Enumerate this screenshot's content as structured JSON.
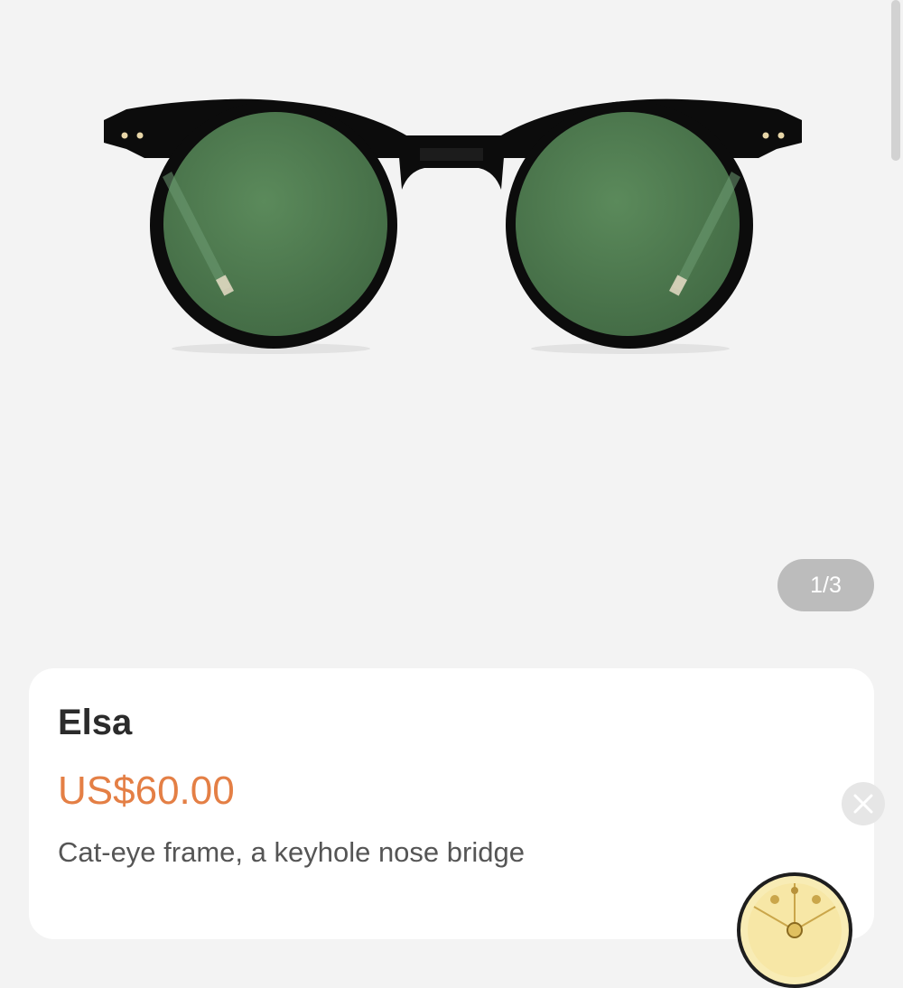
{
  "gallery": {
    "image": "sunglasses-product-photo",
    "counter": "1/3"
  },
  "product": {
    "name": "Elsa",
    "price": "US$60.00",
    "description": "Cat-eye frame, a keyhole nose bridge"
  },
  "colors": {
    "background": "#f3f3f3",
    "card": "#ffffff",
    "price": "#e47f45",
    "title": "#2b2b2b",
    "lens": "#4f7a4f",
    "frame": "#0c0c0c"
  },
  "icons": {
    "close": "close-icon",
    "promo": "prize-wheel-icon"
  }
}
